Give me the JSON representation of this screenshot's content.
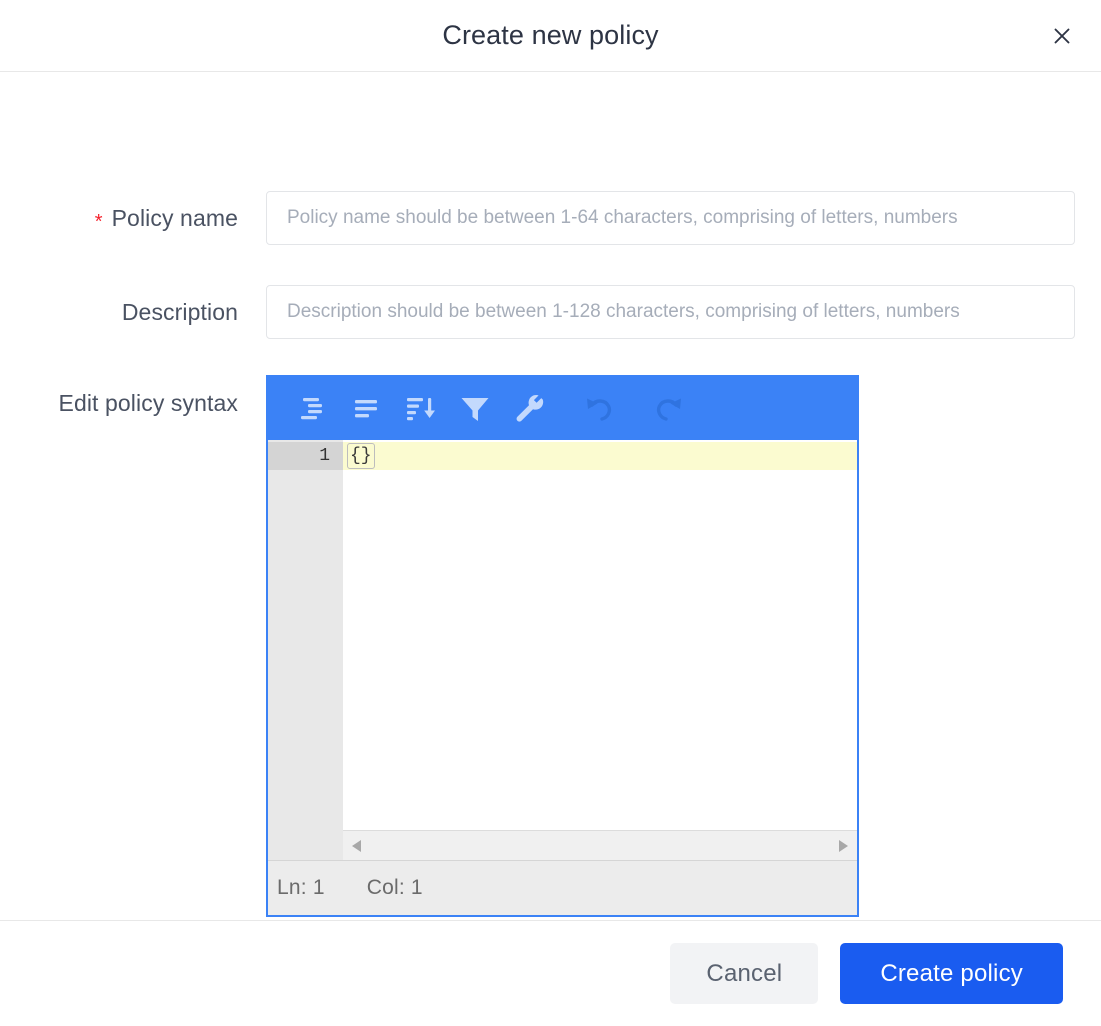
{
  "dialog": {
    "title": "Create new policy",
    "close_icon": "close-icon"
  },
  "form": {
    "policy_name": {
      "label": "Policy name",
      "required_marker": "*",
      "required": true,
      "value": "",
      "placeholder": "Policy name should be between 1-64 characters, comprising of letters, numbers"
    },
    "description": {
      "label": "Description",
      "required": false,
      "value": "",
      "placeholder": "Description should be between 1-128 characters, comprising of letters, numbers"
    },
    "editor": {
      "label": "Edit policy syntax",
      "toolbar": [
        {
          "name": "format-compact-icon",
          "icon": "align-indent-icon",
          "state": "enabled"
        },
        {
          "name": "format-expand-icon",
          "icon": "align-left-icon",
          "state": "enabled"
        },
        {
          "name": "sort-icon",
          "icon": "sort-descending-icon",
          "state": "enabled"
        },
        {
          "name": "filter-icon",
          "icon": "funnel-icon",
          "state": "enabled"
        },
        {
          "name": "repair-icon",
          "icon": "wrench-icon",
          "state": "enabled"
        },
        {
          "name": "undo-icon",
          "icon": "undo-arrow-icon",
          "state": "disabled"
        },
        {
          "name": "redo-icon",
          "icon": "redo-arrow-icon",
          "state": "disabled"
        }
      ],
      "lines": [
        {
          "number": "1",
          "content": "{}",
          "active": true
        }
      ],
      "status": {
        "line_label": "Ln: 1",
        "column_label": "Col: 1"
      },
      "scrollbar": {
        "left_arrow": "chevron-left-icon",
        "right_arrow": "chevron-right-icon"
      }
    }
  },
  "footer": {
    "cancel_label": "Cancel",
    "submit_label": "Create policy"
  },
  "colors": {
    "toolbar_blue": "#3b82f6",
    "primary_blue": "#1a5cf0",
    "required_red": "#f5222d",
    "active_line_yellow": "#fbfbd0",
    "gutter_gray": "#e8e8e8"
  }
}
